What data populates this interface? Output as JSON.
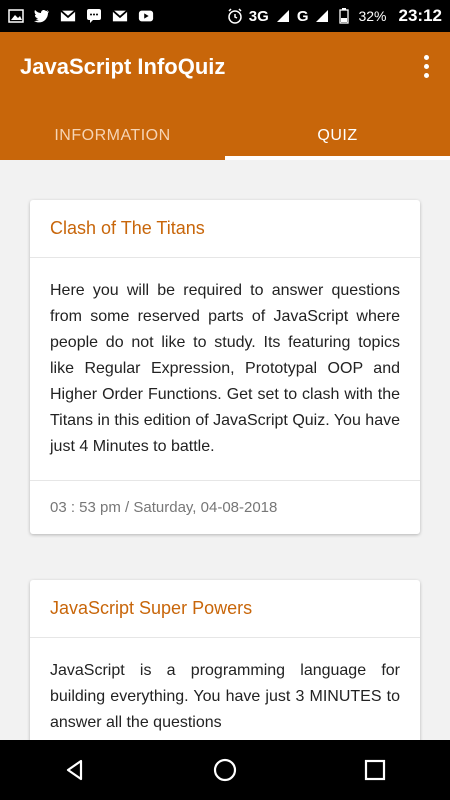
{
  "status_bar": {
    "icons_left": [
      "image-icon",
      "twitter-icon",
      "gmail-icon",
      "messenger-icon",
      "gmail-icon",
      "youtube-icon"
    ],
    "network": "3G",
    "network2": "G",
    "battery": "32%",
    "time": "23:12"
  },
  "app": {
    "title": "JavaScript InfoQuiz",
    "tabs": [
      {
        "label": "INFORMATION",
        "active": false
      },
      {
        "label": "QUIZ",
        "active": true
      }
    ]
  },
  "cards": [
    {
      "title": "Clash of The Titans",
      "body": "Here you will be required to answer questions from some reserved parts of JavaScript where people do not like to study. Its featuring topics like Regular Expression, Prototypal OOP and Higher Order Functions. Get set to clash with the Titans in this edition of JavaScript Quiz. You have just 4 Minutes to battle.",
      "footer": "03 : 53 pm / Saturday, 04-08-2018"
    },
    {
      "title": "JavaScript Super Powers",
      "body": "JavaScript is a programming language for building everything. You have just 3 MINUTES to answer all the questions"
    }
  ],
  "colors": {
    "accent": "#c8660a"
  }
}
